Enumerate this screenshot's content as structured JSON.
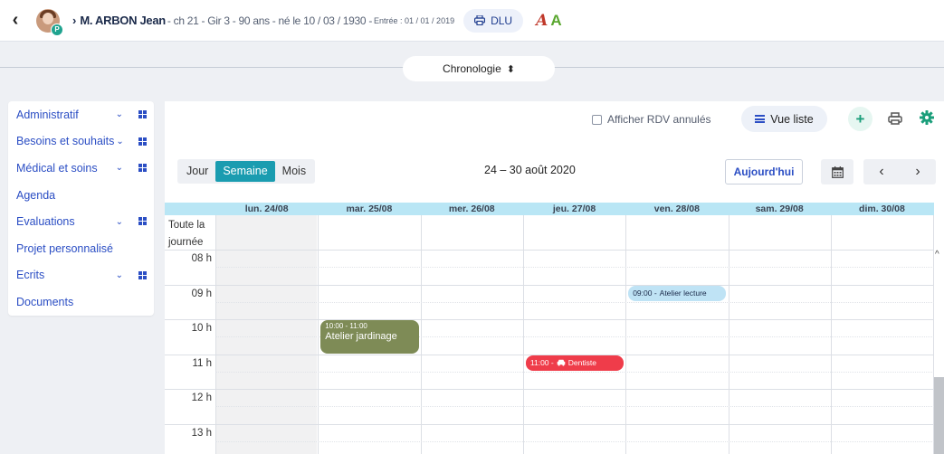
{
  "header": {
    "back": "‹",
    "chevron": "›",
    "avatar_badge": "P",
    "patient_name": "M. ARBON Jean",
    "patient_info": " - ch 21 - Gir 3 - 90 ans - né le 10 / 03 / 1930 - ",
    "patient_entry": "Entrée : 01 / 01 / 2019",
    "dlu_label": "DLU",
    "logo_a": "A",
    "logo_b": "A"
  },
  "chronologie": {
    "label": "Chronologie",
    "caret": "⬍"
  },
  "sidebar": {
    "items": [
      {
        "label": "Administratif",
        "has_chevron": true,
        "has_grid": true
      },
      {
        "label": "Besoins et souhaits",
        "has_chevron": true,
        "has_grid": true
      },
      {
        "label": "Médical et soins",
        "has_chevron": true,
        "has_grid": true
      },
      {
        "label": "Agenda",
        "has_chevron": false,
        "has_grid": false
      },
      {
        "label": "Evaluations",
        "has_chevron": true,
        "has_grid": true
      },
      {
        "label": "Projet personnalisé",
        "has_chevron": false,
        "has_grid": false
      },
      {
        "label": "Ecrits",
        "has_chevron": true,
        "has_grid": true
      },
      {
        "label": "Documents",
        "has_chevron": false,
        "has_grid": false
      }
    ],
    "chevron_glyph": "⌄"
  },
  "toolbar": {
    "show_cancelled_label": "Afficher RDV annulés",
    "show_cancelled_checked": false,
    "vue_liste_label": "Vue liste",
    "add_label": "+"
  },
  "nav": {
    "views": [
      "Jour",
      "Semaine",
      "Mois"
    ],
    "active_view": "Semaine",
    "range_title": "24 – 30 août 2020",
    "today_label": "Aujourd'hui",
    "prev": "‹",
    "next": "›"
  },
  "calendar": {
    "days": [
      "lun. 24/08",
      "mar. 25/08",
      "mer. 26/08",
      "jeu. 27/08",
      "ven. 28/08",
      "sam. 29/08",
      "dim. 30/08"
    ],
    "allday_label": "Toute la journée",
    "hours": [
      "08 h",
      "09 h",
      "10 h",
      "11 h",
      "12 h",
      "13 h"
    ],
    "events": [
      {
        "day": 1,
        "start": 10,
        "end": 11,
        "time": "10:00 - 11:00",
        "title": "Atelier jardinage",
        "color": "#7e8b56",
        "text_color": "#ffffff",
        "layout": "block"
      },
      {
        "day": 3,
        "start": 11,
        "end": 11.5,
        "time": "11:00 -",
        "title": "Dentiste",
        "icon": "car-icon",
        "color": "#ef3c4a",
        "text_color": "#ffffff",
        "layout": "inline"
      },
      {
        "day": 4,
        "start": 9,
        "end": 9.5,
        "time": "09:00 -",
        "title": "Atelier lecture",
        "color": "#bfe3f5",
        "text_color": "#1b2a4a",
        "layout": "inline"
      }
    ]
  },
  "colors": {
    "accent_blue": "#2b4ec4",
    "teal_active": "#1a9cb0",
    "header_day_bg": "#b9e6f5",
    "green_add": "#1a9e7a"
  }
}
